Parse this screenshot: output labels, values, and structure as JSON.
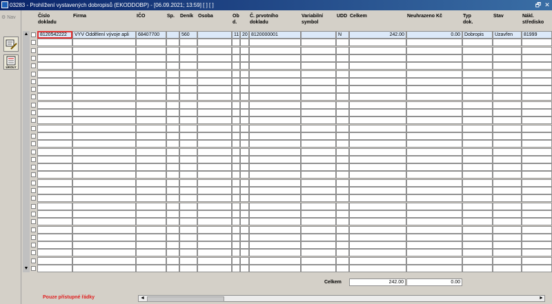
{
  "window": {
    "title": "03283 - Prohlížení vystavených dobropisů (EKODDOBP) - [06.09.2021; 13:59] [ ] [ ]",
    "restore_glyph": "🗗",
    "close_glyph": "✕"
  },
  "nav": {
    "label": "Nav"
  },
  "toolbar": {
    "tools": [
      "edit-document-icon",
      "tasks-icon"
    ],
    "tasks_label": "ÚKOLY"
  },
  "columns": [
    {
      "key": "cislo",
      "label": "Číslo\ndokladu"
    },
    {
      "key": "firma",
      "label": "Firma"
    },
    {
      "key": "ico",
      "label": "IČO"
    },
    {
      "key": "sp",
      "label": "Sp."
    },
    {
      "key": "denik",
      "label": "Deník"
    },
    {
      "key": "osoba",
      "label": "Osoba"
    },
    {
      "key": "obd",
      "label": "Ob\nd."
    },
    {
      "key": "obd2",
      "label": ""
    },
    {
      "key": "prvotni",
      "label": "Č. prvotního\ndokladu"
    },
    {
      "key": "vs",
      "label": "Variabilní\nsymbol"
    },
    {
      "key": "udd",
      "label": "UDD"
    },
    {
      "key": "celkem",
      "label": "Celkem"
    },
    {
      "key": "neuhrazeno",
      "label": "Neuhrazeno Kč"
    },
    {
      "key": "typ",
      "label": "Typ\ndok."
    },
    {
      "key": "stav",
      "label": "Stav"
    },
    {
      "key": "nakl",
      "label": "Nákl.\nstředisko"
    }
  ],
  "rows": [
    [
      "8120542222",
      "VYV Oddělení vývoje apli",
      "68407700",
      "",
      "560",
      "",
      "11",
      "20",
      "8120000001",
      "",
      "N",
      "242.00",
      "0.00",
      "Dobropis",
      "Uzavřen",
      "81999"
    ]
  ],
  "empty_row_count": 30,
  "totals": {
    "label": "Celkem",
    "celkem": "242.00",
    "neuhrazeno": "0.00"
  },
  "footer": {
    "status": "Pouze přístupné řádky"
  },
  "colors": {
    "status_red": "#e02020",
    "selected_row": "#dce9f8",
    "titlebar": "#0a246a"
  }
}
